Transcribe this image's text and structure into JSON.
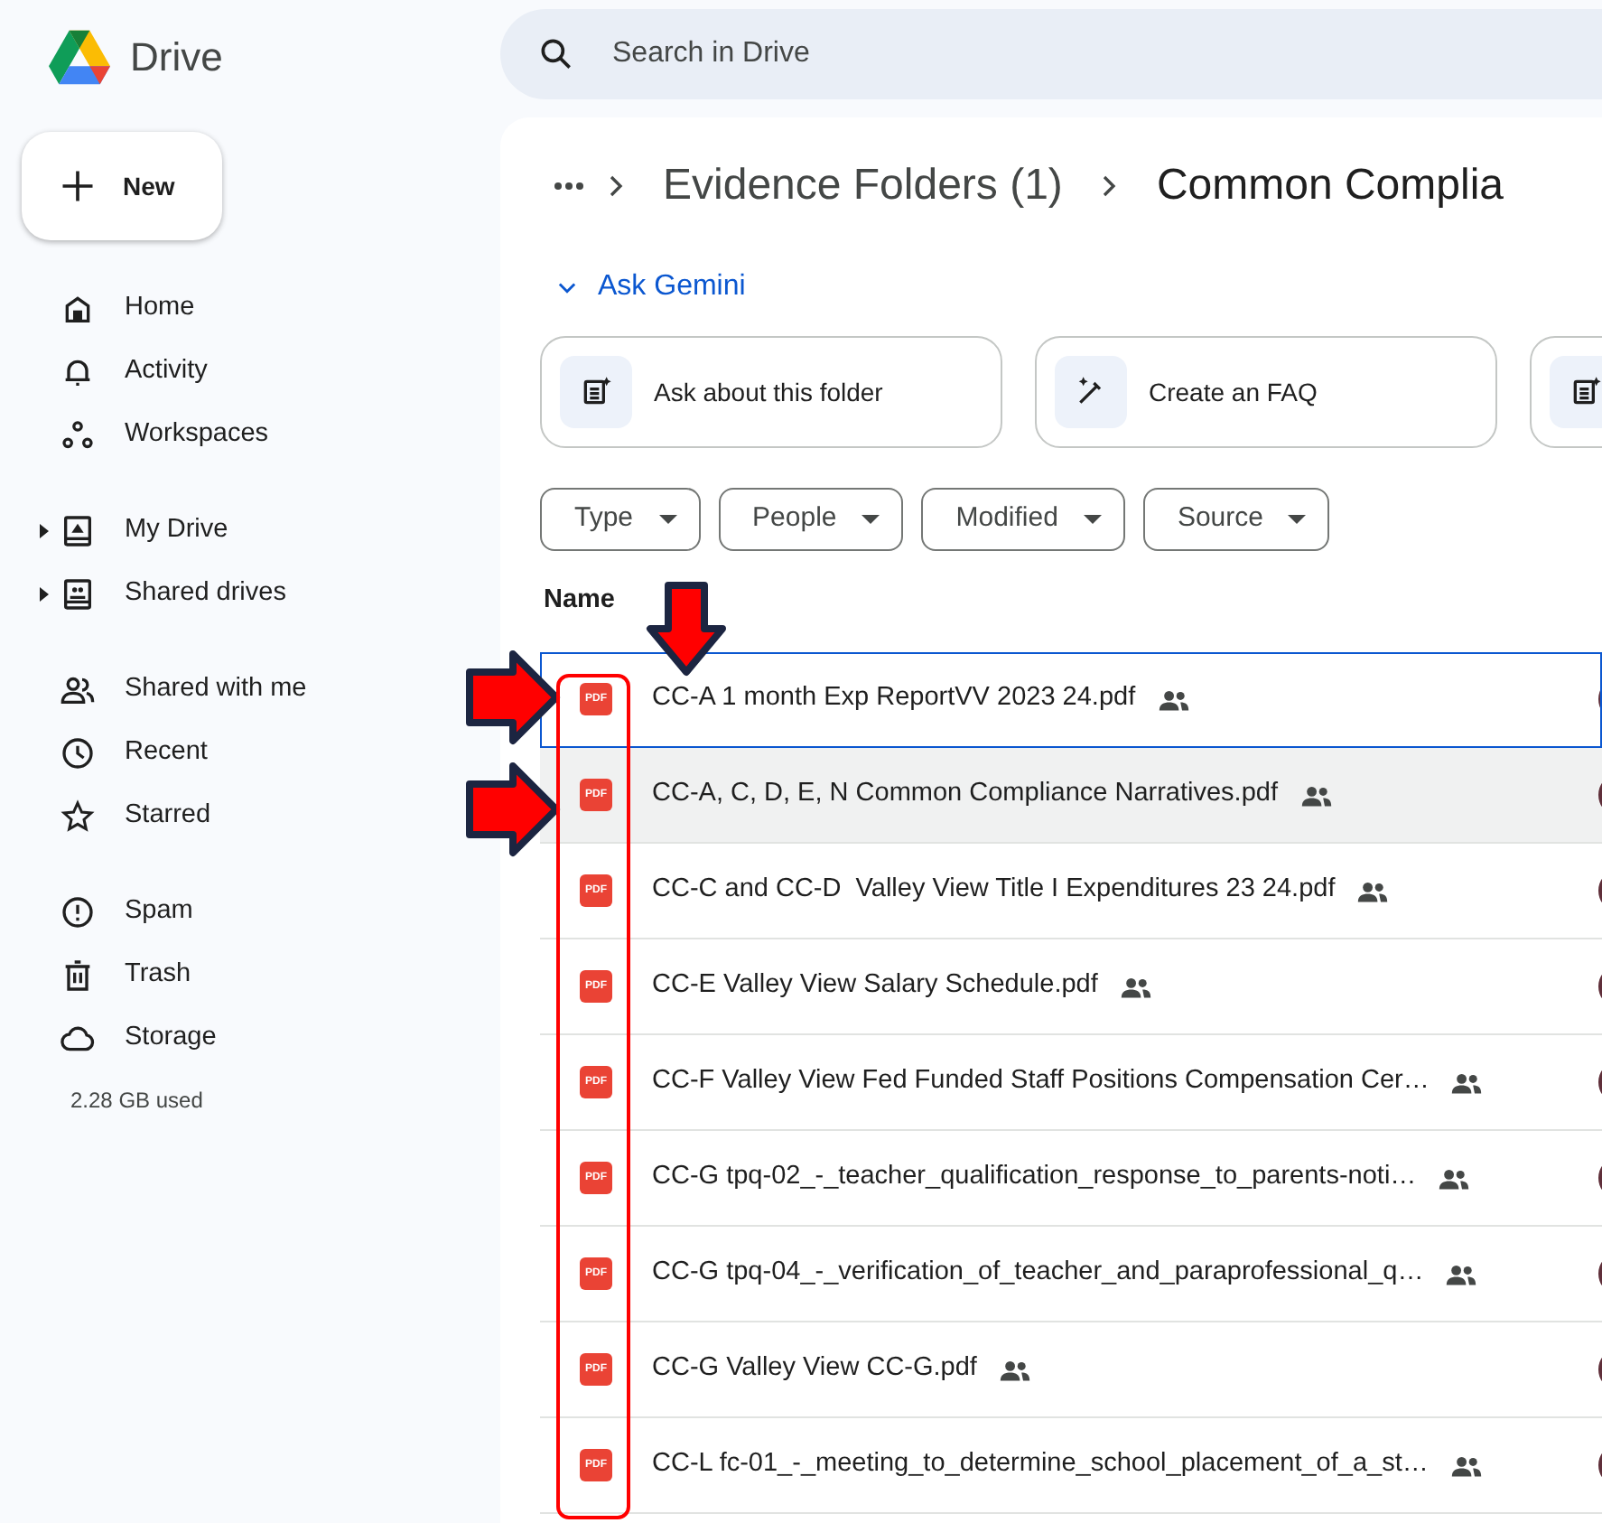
{
  "app": {
    "name": "Drive"
  },
  "search": {
    "placeholder": "Search in Drive"
  },
  "new_button": {
    "label": "New"
  },
  "sidebar": {
    "sections": [
      {
        "items": [
          {
            "label": "Home",
            "expandable": false
          },
          {
            "label": "Activity",
            "expandable": false
          },
          {
            "label": "Workspaces",
            "expandable": false
          }
        ]
      },
      {
        "items": [
          {
            "label": "My Drive",
            "expandable": true
          },
          {
            "label": "Shared drives",
            "expandable": true
          }
        ]
      },
      {
        "items": [
          {
            "label": "Shared with me",
            "expandable": false
          },
          {
            "label": "Recent",
            "expandable": false
          },
          {
            "label": "Starred",
            "expandable": false
          }
        ]
      },
      {
        "items": [
          {
            "label": "Spam",
            "expandable": false
          },
          {
            "label": "Trash",
            "expandable": false
          },
          {
            "label": "Storage",
            "expandable": false
          }
        ]
      }
    ],
    "storage_used": "2.28 GB used"
  },
  "breadcrumb": [
    {
      "label": "Evidence Folders (1)"
    },
    {
      "label": "Common Complia"
    }
  ],
  "gemini": {
    "label": "Ask Gemini",
    "expanded": true,
    "cards": [
      {
        "kind": "document",
        "label": "Ask about this folder"
      },
      {
        "kind": "pen",
        "label": "Create an FAQ"
      },
      {
        "kind": "document"
      }
    ]
  },
  "filters": [
    {
      "label": "Type"
    },
    {
      "label": "People"
    },
    {
      "label": "Modified"
    },
    {
      "label": "Source"
    }
  ],
  "table": {
    "columns": [
      {
        "label": "Name"
      }
    ],
    "rows": [
      {
        "file_type": "PDF",
        "name": "CC-A 1 month Exp ReportVV 2023 24.pdf",
        "shared": true,
        "focused": true,
        "hovered": false
      },
      {
        "file_type": "PDF",
        "name": "CC-A, C, D, E, N Common Compliance Narratives.pdf",
        "shared": true,
        "focused": false,
        "hovered": true
      },
      {
        "file_type": "PDF",
        "name": "CC-C and CC-D  Valley View Title I Expenditures 23 24.pdf",
        "shared": true,
        "focused": false,
        "hovered": false
      },
      {
        "file_type": "PDF",
        "name": "CC-E Valley View Salary Schedule.pdf",
        "shared": true,
        "focused": false,
        "hovered": false
      },
      {
        "file_type": "PDF",
        "name": "CC-F Valley View Fed Funded Staff Positions Compensation Cer…",
        "shared": true,
        "focused": false,
        "hovered": false
      },
      {
        "file_type": "PDF",
        "name": "CC-G tpq-02_-_teacher_qualification_response_to_parents-noti…",
        "shared": true,
        "focused": false,
        "hovered": false
      },
      {
        "file_type": "PDF",
        "name": "CC-G tpq-04_-_verification_of_teacher_and_paraprofessional_q…",
        "shared": true,
        "focused": false,
        "hovered": false
      },
      {
        "file_type": "PDF",
        "name": "CC-G Valley View CC-G.pdf",
        "shared": true,
        "focused": false,
        "hovered": false
      },
      {
        "file_type": "PDF",
        "name": "CC-L fc-01_-_meeting_to_determine_school_placement_of_a_st…",
        "shared": true,
        "focused": false,
        "hovered": false
      }
    ]
  }
}
